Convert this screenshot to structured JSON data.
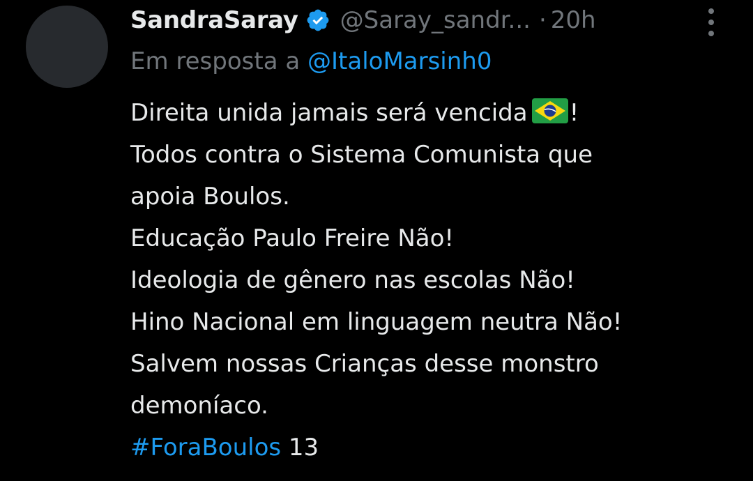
{
  "tweet": {
    "display_name": "SandraSaray",
    "verified_icon": "verified-badge-icon",
    "handle": "@Saray_sandr...",
    "separator": "·",
    "timestamp": "20h",
    "more_icon": "more-options-icon",
    "reply_prefix": "Em resposta a",
    "reply_target": "@ItaloMarsinh0",
    "lines": [
      "Direita unida jamais será vencida",
      "!",
      "Todos contra o Sistema Comunista que",
      "apoia Boulos.",
      "Educação Paulo Freire Não!",
      "Ideologia de gênero nas escolas Não!",
      "Hino Nacional em linguagem neutra Não!",
      "Salvem nossas Crianças desse monstro",
      "demoníaco."
    ],
    "flag_emoji": "brazil-flag-icon",
    "hashtag": "#ForaBoulos",
    "hashtag_suffix": "13"
  },
  "colors": {
    "background": "#000000",
    "text": "#e7e9ea",
    "muted": "#71767b",
    "accent": "#1d9bf0"
  }
}
